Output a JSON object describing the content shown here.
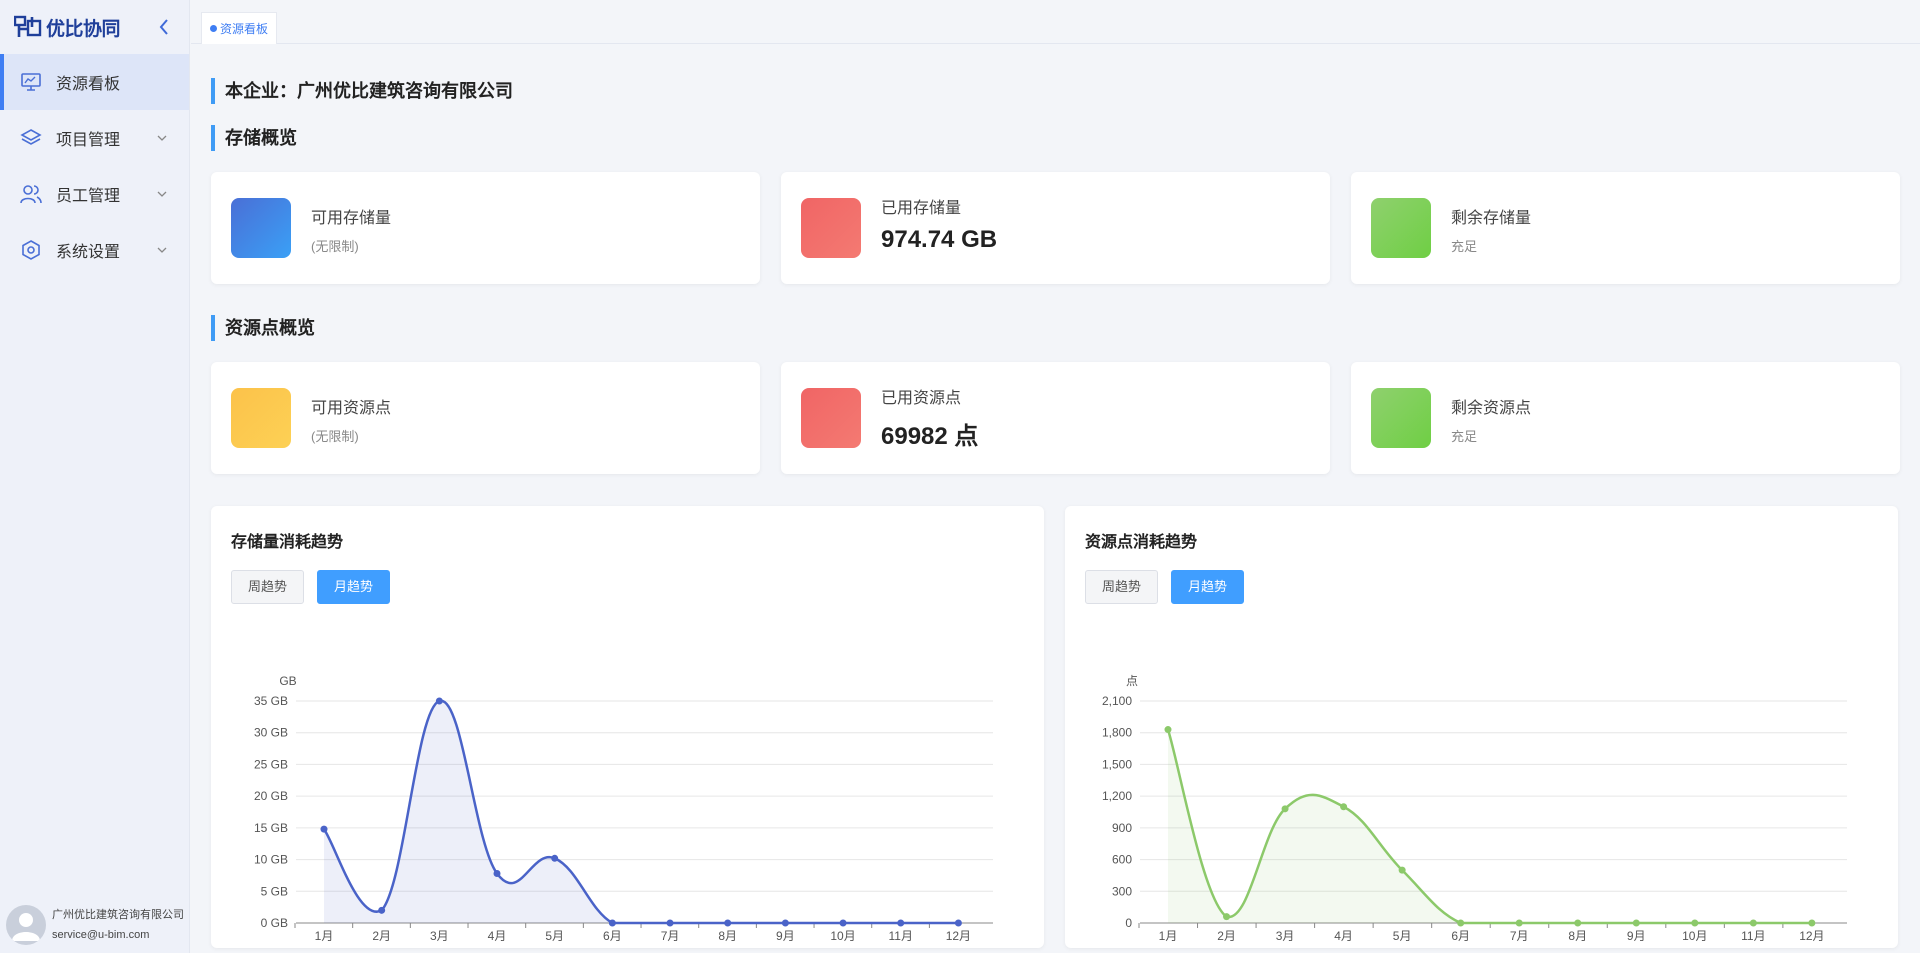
{
  "sidebar": {
    "logo_text": "优比协同",
    "items": [
      {
        "label": "资源看板",
        "icon": "monitor-icon",
        "active": true
      },
      {
        "label": "项目管理",
        "icon": "layers-icon"
      },
      {
        "label": "员工管理",
        "icon": "users-icon"
      },
      {
        "label": "系统设置",
        "icon": "settings-hexagon-icon"
      }
    ],
    "user": {
      "company": "广州优比建筑咨询有限公司",
      "email": "service@u-bim.com"
    }
  },
  "tabbar": {
    "active_tab": "资源看板"
  },
  "main": {
    "enterprise_title": "本企业：广州优比建筑咨询有限公司",
    "storage_section": "存储概览",
    "resource_section": "资源点概览",
    "storage_cards": [
      {
        "label": "可用存储量",
        "sub": "(无限制)",
        "color": "#3a8ef0"
      },
      {
        "label": "已用存储量",
        "value": "974.74 GB",
        "color": "#f06565"
      },
      {
        "label": "剩余存储量",
        "sub": "充足",
        "color": "#72cf48"
      }
    ],
    "resource_cards": [
      {
        "label": "可用资源点",
        "sub": "(无限制)",
        "color": "#fcc24a"
      },
      {
        "label": "已用资源点",
        "value": "69982 点",
        "color": "#f06565"
      },
      {
        "label": "剩余资源点",
        "sub": "充足",
        "color": "#72cf48"
      }
    ],
    "charts": [
      {
        "title": "存储量消耗趋势",
        "btn_week": "周趋势",
        "btn_month": "月趋势"
      },
      {
        "title": "资源点消耗趋势",
        "btn_week": "周趋势",
        "btn_month": "月趋势"
      }
    ]
  },
  "chart_data": [
    {
      "type": "line",
      "title": "存储量消耗趋势",
      "ylabel": "GB",
      "categories": [
        "1月",
        "2月",
        "3月",
        "4月",
        "5月",
        "6月",
        "7月",
        "8月",
        "9月",
        "10月",
        "11月",
        "12月"
      ],
      "values": [
        14.8,
        2,
        35,
        7.8,
        10.2,
        0,
        0,
        0,
        0,
        0,
        0,
        0
      ],
      "yticks": [
        "0 GB",
        "5 GB",
        "10 GB",
        "15 GB",
        "20 GB",
        "25 GB",
        "30 GB",
        "35 GB"
      ],
      "ylim": [
        0,
        35
      ],
      "smooth": true,
      "area": true,
      "grid": true,
      "color": "#4a63c8"
    },
    {
      "type": "line",
      "title": "资源点消耗趋势",
      "ylabel": "点",
      "categories": [
        "1月",
        "2月",
        "3月",
        "4月",
        "5月",
        "6月",
        "7月",
        "8月",
        "9月",
        "10月",
        "11月",
        "12月"
      ],
      "values": [
        1830,
        60,
        1080,
        1100,
        500,
        0,
        0,
        0,
        0,
        0,
        0,
        0
      ],
      "yticks": [
        "0",
        "300",
        "600",
        "900",
        "1,200",
        "1,500",
        "1,800",
        "2,100"
      ],
      "ylim": [
        0,
        2100
      ],
      "smooth": true,
      "area": true,
      "grid": true,
      "color": "#8cc96a"
    }
  ]
}
